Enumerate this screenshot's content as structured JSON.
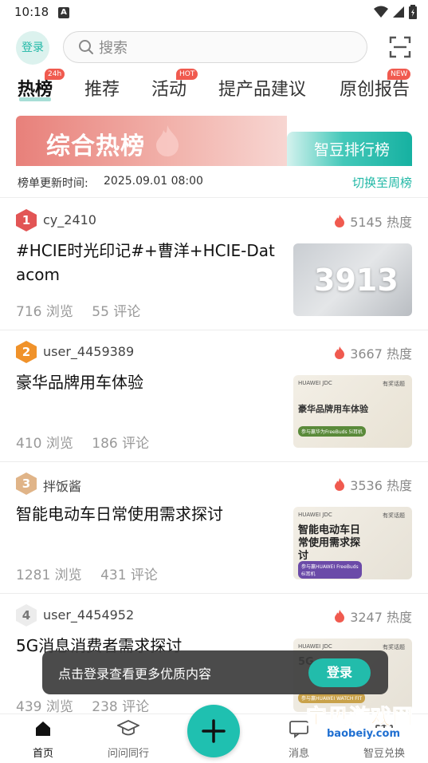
{
  "status_bar": {
    "time": "10:18",
    "notif_letter": "A"
  },
  "header": {
    "login_label": "登录",
    "search_placeholder": "搜索"
  },
  "tabs": [
    {
      "label": "热榜",
      "badge": "24h"
    },
    {
      "label": "推荐",
      "badge": ""
    },
    {
      "label": "活动",
      "badge": "HOT"
    },
    {
      "label": "提产品建议",
      "badge": ""
    },
    {
      "label": "原创报告",
      "badge": "NEW"
    }
  ],
  "banner": {
    "left_title": "综合热榜",
    "right_title": "智豆排行榜"
  },
  "update": {
    "label": "榜单更新时间:",
    "time": "2025.09.01 08:00",
    "switch_label": "切换至周榜"
  },
  "items": [
    {
      "rank": "1",
      "rank_color": "#e25555",
      "author": "cy_2410",
      "heat": "5145 热度",
      "title": "#HCIE时光印记#+曹洋+HCIE-Datacom",
      "views": "716 浏览",
      "comments": "55 评论",
      "thumb_text": "3913"
    },
    {
      "rank": "2",
      "rank_color": "#f0922a",
      "author": "user_4459389",
      "heat": "3667 热度",
      "title": "豪华品牌用车体验",
      "views": "410 浏览",
      "comments": "186 评论",
      "thumb_brand": "HUAWEI JDC",
      "thumb_tag": "有奖话题",
      "thumb_title": "豪华品牌用车体验",
      "thumb_sub": "参与赢华为FreeBuds 5i耳机"
    },
    {
      "rank": "3",
      "rank_color": "#e0b488",
      "author": "拌饭酱",
      "heat": "3536 热度",
      "title": "智能电动车日常使用需求探讨",
      "views": "1281 浏览",
      "comments": "431 评论",
      "thumb_brand": "HUAWEI JDC",
      "thumb_tag": "有奖话题",
      "thumb_title": "智能电动车日常使用需求探讨",
      "thumb_sub": "参与赢HUAWEI FreeBuds 6i耳机"
    },
    {
      "rank": "4",
      "rank_color": "#e6e6e6",
      "author": "user_4454952",
      "heat": "3247 热度",
      "title": "5G消息消费者需求探讨",
      "views": "439 浏览",
      "comments": "238 评论",
      "thumb_brand": "HUAWEI JDC",
      "thumb_tag": "有奖话题",
      "thumb_title": "5G",
      "thumb_sub": "参与赢HUAWEI WATCH FIT"
    }
  ],
  "toast": {
    "text": "点击登录查看更多优质内容",
    "button": "登录"
  },
  "bottom_nav": [
    {
      "label": "首页"
    },
    {
      "label": "问问同行"
    },
    {
      "label": "消息"
    },
    {
      "label": "智豆兑换"
    }
  ],
  "watermark": {
    "line1": "宝贝游戏网",
    "line2": "baobeiy.com"
  },
  "colors": {
    "accent": "#21b8a6",
    "hot": "#f05a4f"
  }
}
